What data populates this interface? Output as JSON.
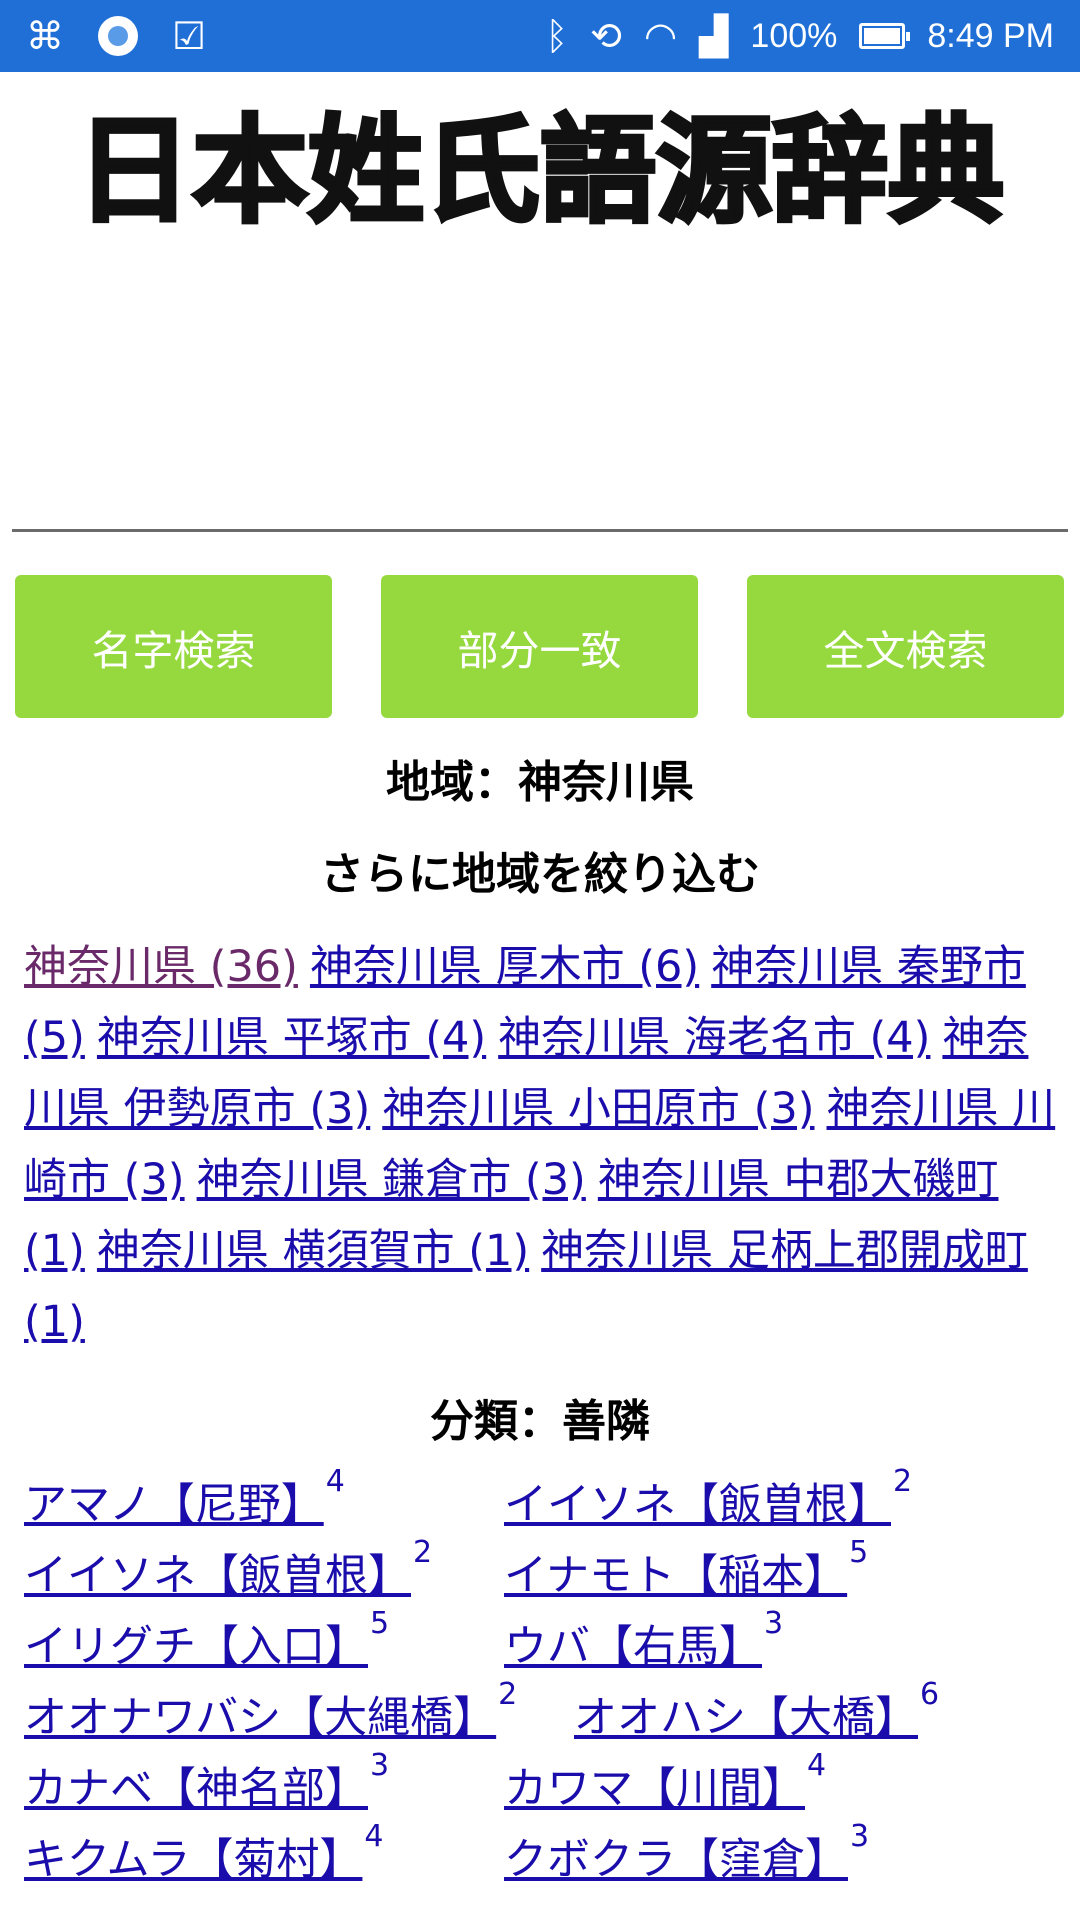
{
  "status_bar": {
    "battery": "100%",
    "time": "8:49 PM",
    "icons": [
      "app-icon",
      "circle-app-icon",
      "check-app-icon",
      "bluetooth-icon",
      "rotate-icon",
      "wifi-icon",
      "signal-icon",
      "battery-icon"
    ]
  },
  "logo": {
    "text": "日本姓氏語源辞典"
  },
  "buttons": {
    "name_search": "名字検索",
    "partial_match": "部分一致",
    "fulltext_search": "全文検索"
  },
  "region": {
    "heading": "地域：神奈川県",
    "subheading": "さらに地域を絞り込む",
    "links": [
      "神奈川県 (36)",
      "神奈川県 厚木市 (6)",
      "神奈川県 秦野市 (5)",
      "神奈川県 平塚市 (4)",
      "神奈川県 海老名市 (4)",
      "神奈川県 伊勢原市 (3)",
      "神奈川県 小田原市 (3)",
      "神奈川県 川崎市 (3)",
      "神奈川県 鎌倉市 (3)",
      "神奈川県 中郡大磯町 (1)",
      "神奈川県 横須賀市 (1)",
      "神奈川県 足柄上郡開成町 (1)"
    ]
  },
  "category": {
    "heading": "分類：善隣",
    "names": [
      {
        "label": "アマノ【尼野】",
        "count": "4"
      },
      {
        "label": "イイソネ【飯曽根】",
        "count": "2"
      },
      {
        "label": "イイソネ【飯曽根】",
        "count": "2"
      },
      {
        "label": "イナモト【稲本】",
        "count": "5"
      },
      {
        "label": "イリグチ【入口】",
        "count": "5"
      },
      {
        "label": "ウバ【右馬】",
        "count": "3"
      },
      {
        "label": "オオナワバシ【大縄橋】",
        "count": "2"
      },
      {
        "label": "オオハシ【大橋】",
        "count": "6"
      },
      {
        "label": "カナベ【神名部】",
        "count": "3"
      },
      {
        "label": "カワマ【川間】",
        "count": "4"
      },
      {
        "label": "キクムラ【菊村】",
        "count": "4"
      },
      {
        "label": "クボクラ【窪倉】",
        "count": "3"
      }
    ]
  }
}
